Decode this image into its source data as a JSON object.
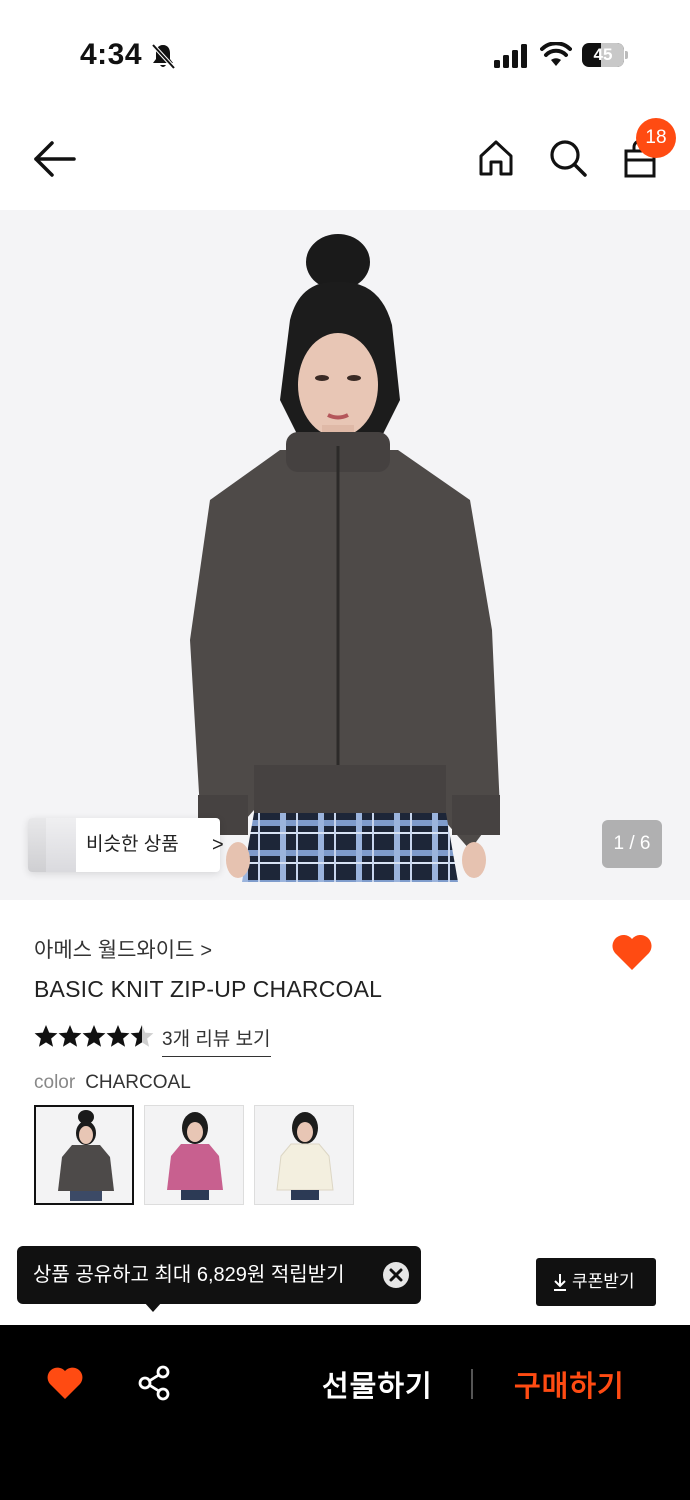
{
  "status_bar": {
    "time": "4:34",
    "battery": "45",
    "icons": [
      "bell-off-icon",
      "signal-icon",
      "wifi-icon",
      "battery-icon"
    ]
  },
  "header": {
    "cart_count": "18",
    "icons": [
      "back-arrow-icon",
      "home-icon",
      "search-icon",
      "shopping-bag-icon"
    ]
  },
  "gallery": {
    "similar_label": "비슷한 상품",
    "similar_chevron": ">",
    "page_counter": "1 / 6",
    "current_page": 1,
    "total_pages": 6
  },
  "product": {
    "brand": "아메스 월드와이드",
    "brand_chevron": ">",
    "title": "BASIC KNIT ZIP-UP CHARCOAL",
    "rating": 4.5,
    "rating_max": 5,
    "review_link": "3개 리뷰 보기",
    "color_key": "color",
    "color_value": "CHARCOAL",
    "favorited": true,
    "color_swatches": [
      {
        "name": "charcoal",
        "color": "#4d4a49",
        "selected": true
      },
      {
        "name": "pink",
        "color": "#c8608f",
        "selected": false
      },
      {
        "name": "ivory",
        "color": "#f3efdf",
        "selected": false
      }
    ]
  },
  "toast": {
    "text": "상품 공유하고 최대 6,829원 적립받기"
  },
  "coupon": {
    "label": "쿠폰받기"
  },
  "bottom_bar": {
    "gift_label": "선물하기",
    "buy_label": "구매하기"
  },
  "colors": {
    "accent": "#ff4b12",
    "bar_background": "#000000"
  }
}
